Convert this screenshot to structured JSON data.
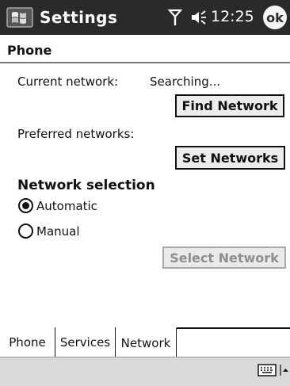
{
  "titlebar": {
    "title": "Settings",
    "time": "12:25",
    "ok_label": "ok"
  },
  "page": {
    "title": "Phone"
  },
  "network": {
    "current_label": "Current network:",
    "current_value": "Searching...",
    "find_button": "Find Network",
    "preferred_label": "Preferred networks:",
    "set_button": "Set Networks",
    "selection_heading": "Network selection",
    "options": [
      {
        "label": "Automatic",
        "selected": true
      },
      {
        "label": "Manual",
        "selected": false
      }
    ],
    "select_button": "Select Network"
  },
  "tabs": [
    {
      "label": "Phone",
      "active": false
    },
    {
      "label": "Services",
      "active": false
    },
    {
      "label": "Network",
      "active": true
    }
  ],
  "icons": {
    "start": "windows-flag-icon",
    "signal": "antenna-icon",
    "volume": "speaker-icon",
    "keyboard": "keyboard-icon",
    "sip": "chevron-up-icon"
  },
  "colors": {
    "titlebar": "#2a2a2a",
    "menubar": "#d9d9d9",
    "disabled_text": "#8e8e8e"
  }
}
